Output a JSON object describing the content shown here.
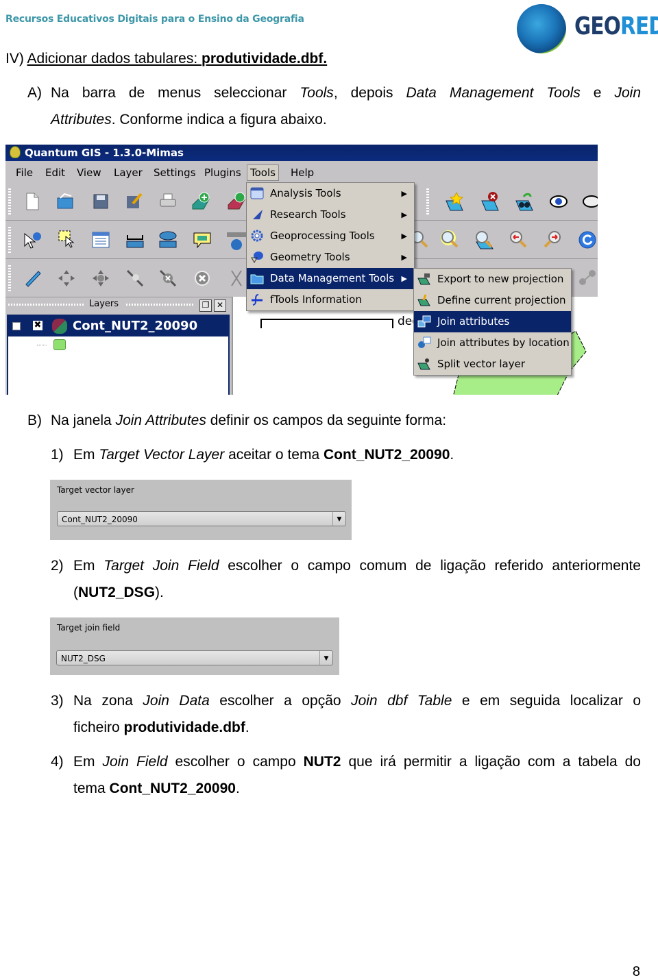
{
  "header": {
    "title": "Recursos Educativos Digitais para o Ensino da Geografia",
    "logo": {
      "part1": "GEO",
      "part2": "RED",
      "icon": "globe-icon"
    }
  },
  "section": {
    "number": "IV) ",
    "title": "Adicionar dados tabulares: ",
    "title_bold": "produtividade.dbf."
  },
  "step_a": {
    "marker": "A)",
    "t1": "Na barra de menus seleccionar ",
    "i1": "Tools",
    "t2": ", depois ",
    "i2": "Data Management Tools",
    "t3": " e ",
    "i3": "Join Attributes",
    "t4": ". Conforme indica a figura abaixo."
  },
  "qgis": {
    "window_title": "Quantum GIS - 1.3.0-Mimas",
    "menubar": [
      "File",
      "Edit",
      "View",
      "Layer",
      "Settings",
      "Plugins",
      "Tools",
      "Help"
    ],
    "tools_menu": [
      {
        "label": "Analysis Tools",
        "icon": "table-icon"
      },
      {
        "label": "Research Tools",
        "icon": "research-icon"
      },
      {
        "label": "Geoprocessing Tools",
        "icon": "gear-icon"
      },
      {
        "label": "Geometry Tools",
        "icon": "geometry-icon"
      },
      {
        "label": "Data Management Tools",
        "icon": "folder-icon",
        "selected": true
      },
      {
        "label": "fTools Information",
        "icon": "ftools-icon"
      }
    ],
    "submenu": [
      {
        "label": "Export to new projection",
        "icon": "export-projection-icon"
      },
      {
        "label": "Define current projection",
        "icon": "define-projection-icon"
      },
      {
        "label": "Join attributes",
        "icon": "join-attributes-icon",
        "selected": true
      },
      {
        "label": "Join attributes by location",
        "icon": "join-location-icon"
      },
      {
        "label": "Split vector layer",
        "icon": "split-layer-icon"
      }
    ],
    "layers_label": "Layers",
    "layer_name": "Cont_NUT2_20090",
    "map_label": "deg"
  },
  "step_b": {
    "marker": "B)",
    "t1": "Na janela ",
    "i1": "Join Attributes",
    "t2": " definir os campos da seguinte forma:"
  },
  "items": [
    {
      "marker": "1)",
      "t1": "Em ",
      "i1": "Target Vector Layer",
      "t2": " aceitar o tema ",
      "b1": "Cont_NUT2_20090",
      "t3": "."
    },
    {
      "marker": "2)",
      "t1": "Em ",
      "i1": "Target Join Field",
      "t2": " escolher o campo comum de ligação referido anteriormente",
      "t3": "(",
      "b1": "NUT2_DSG",
      "t4": ")."
    },
    {
      "marker": "3)",
      "t1": "Na zona ",
      "i1": "Join Data",
      "t2": " escolher a opção ",
      "i2": "Join dbf Table",
      "t3": " e em seguida localizar o",
      "t4": "ficheiro ",
      "b1": "produtividade.dbf",
      "t5": "."
    },
    {
      "marker": "4)",
      "t1": "Em ",
      "i1": "Join Field",
      "t2": " escolher o campo ",
      "b1": "NUT2",
      "t3": " que irá permitir a ligação com a tabela do",
      "t4": "tema ",
      "b2": "Cont_NUT2_20090",
      "t5": "."
    }
  ],
  "dialog1": {
    "label": "Target vector layer",
    "value": "Cont_NUT2_20090"
  },
  "dialog2": {
    "label": "Target join field",
    "value": "NUT2_DSG"
  },
  "page_number": "8"
}
